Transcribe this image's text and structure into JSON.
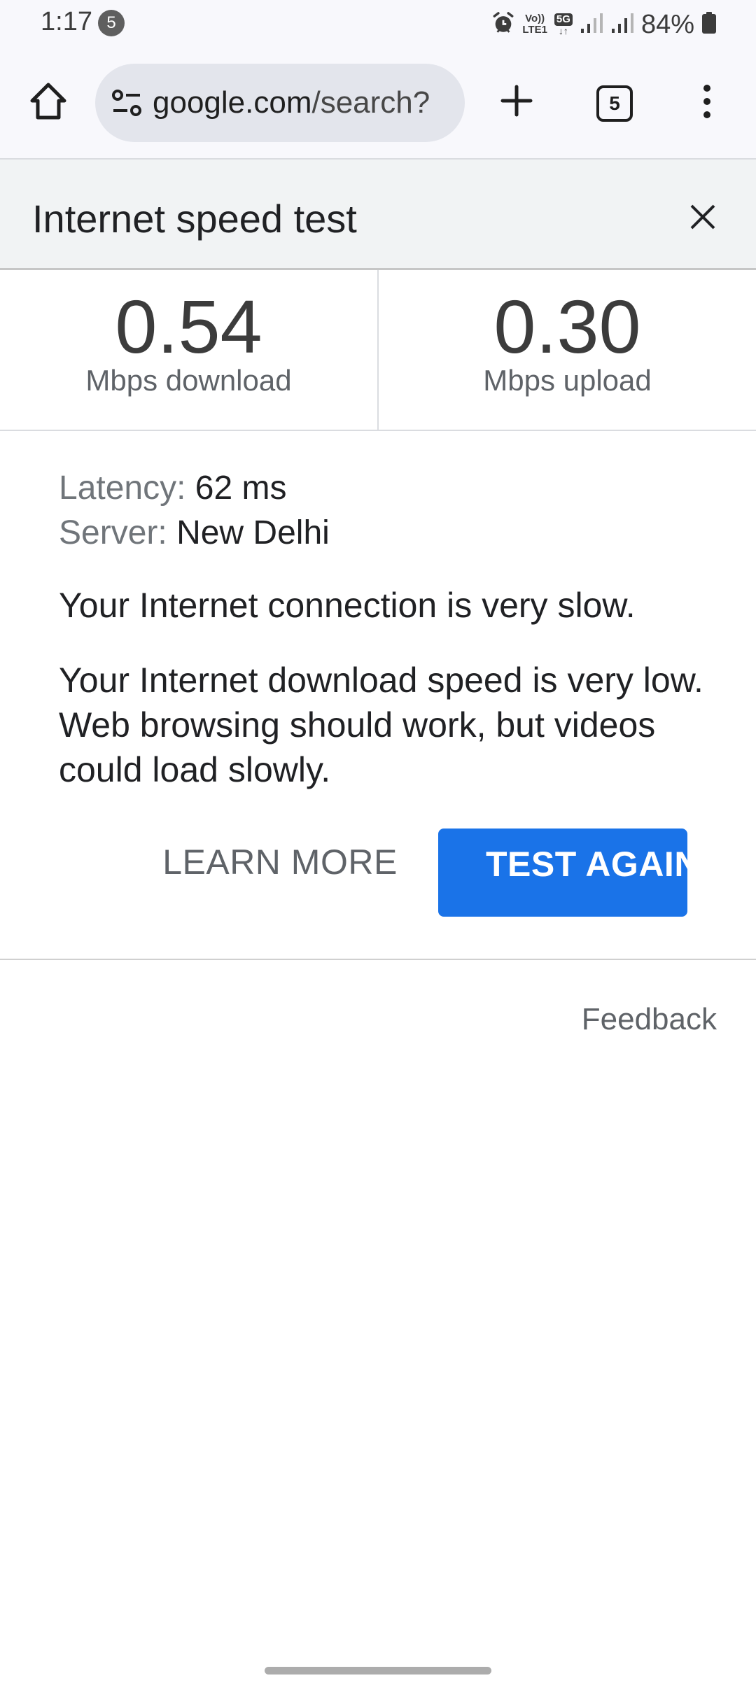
{
  "status_bar": {
    "time": "1:17",
    "notification_count": "5",
    "volte_label_top": "Vo))",
    "volte_label_bottom": "LTE1",
    "network_type": "5G",
    "data_arrows": "↓↑",
    "battery_percent": "84%",
    "icons": [
      "alarm-icon",
      "volte-icon",
      "5g-icon",
      "signal-icon",
      "signal-icon",
      "battery-icon"
    ]
  },
  "browser": {
    "url_host": "google.com",
    "url_path": "/search?",
    "tab_count": "5",
    "icons": [
      "home-icon",
      "site-settings-icon",
      "new-tab-icon",
      "tab-switcher-icon",
      "more-menu-icon"
    ]
  },
  "card": {
    "title": "Internet speed test",
    "download": {
      "value": "0.54",
      "unit": "Mbps download"
    },
    "upload": {
      "value": "0.30",
      "unit": "Mbps upload"
    },
    "latency_label": "Latency:",
    "latency_value": "62 ms",
    "server_label": "Server:",
    "server_value": "New Delhi",
    "summary": "Your Internet connection is very slow.",
    "description": "Your Internet download speed is very low. Web browsing should work, but videos could load slowly.",
    "learn_more_label": "LEARN MORE",
    "test_again_label": "TEST AGAIN",
    "feedback_label": "Feedback"
  },
  "colors": {
    "accent": "#1a73e8",
    "header_bg": "#f1f3f4",
    "omnibox_bg": "#e3e5ec"
  }
}
